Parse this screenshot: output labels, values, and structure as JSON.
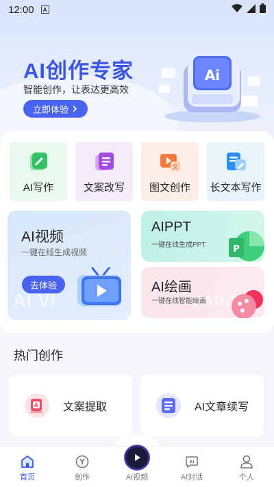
{
  "status_bar": {
    "time": "12:00",
    "sim_label": "A"
  },
  "hero": {
    "title": "AI创作专家",
    "subtitle": "智能创作，让表达更高效",
    "cta_label": "立即体验"
  },
  "tools": [
    {
      "label": "AI写作",
      "icon": "ai-write-icon"
    },
    {
      "label": "文案改写",
      "icon": "rewrite-icon"
    },
    {
      "label": "图文创作",
      "icon": "image-text-icon"
    },
    {
      "label": "长文本写作",
      "icon": "long-text-icon"
    }
  ],
  "feature_cards": {
    "video": {
      "title": "AI视频",
      "subtitle": "一键在线生成视频",
      "button": "去体验",
      "watermark": "AI VI"
    },
    "ppt": {
      "title": "AIPPT",
      "subtitle": "一键在线生成PPT"
    },
    "draw": {
      "title": "AI绘画",
      "subtitle": "一键在线智能绘画",
      "watermark": "PAINTIN"
    }
  },
  "hot_section": {
    "title": "热门创作",
    "items": [
      {
        "label": "文案提取",
        "icon": "text-extract-icon"
      },
      {
        "label": "AI文章续写",
        "icon": "article-continue-icon"
      }
    ]
  },
  "bottom_nav": [
    {
      "label": "首页",
      "icon": "home-icon",
      "active": true
    },
    {
      "label": "创作",
      "icon": "create-icon",
      "active": false
    },
    {
      "label": "AI视频",
      "icon": "ai-video-icon",
      "active": false
    },
    {
      "label": "AI对话",
      "icon": "ai-chat-icon",
      "active": false
    },
    {
      "label": "个人",
      "icon": "profile-icon",
      "active": false
    }
  ],
  "colors": {
    "accent": "#4a63ee",
    "active_nav": "#3b5be6",
    "ppt_card": "#c6f2e7",
    "draw_card": "#fbe6eb"
  }
}
